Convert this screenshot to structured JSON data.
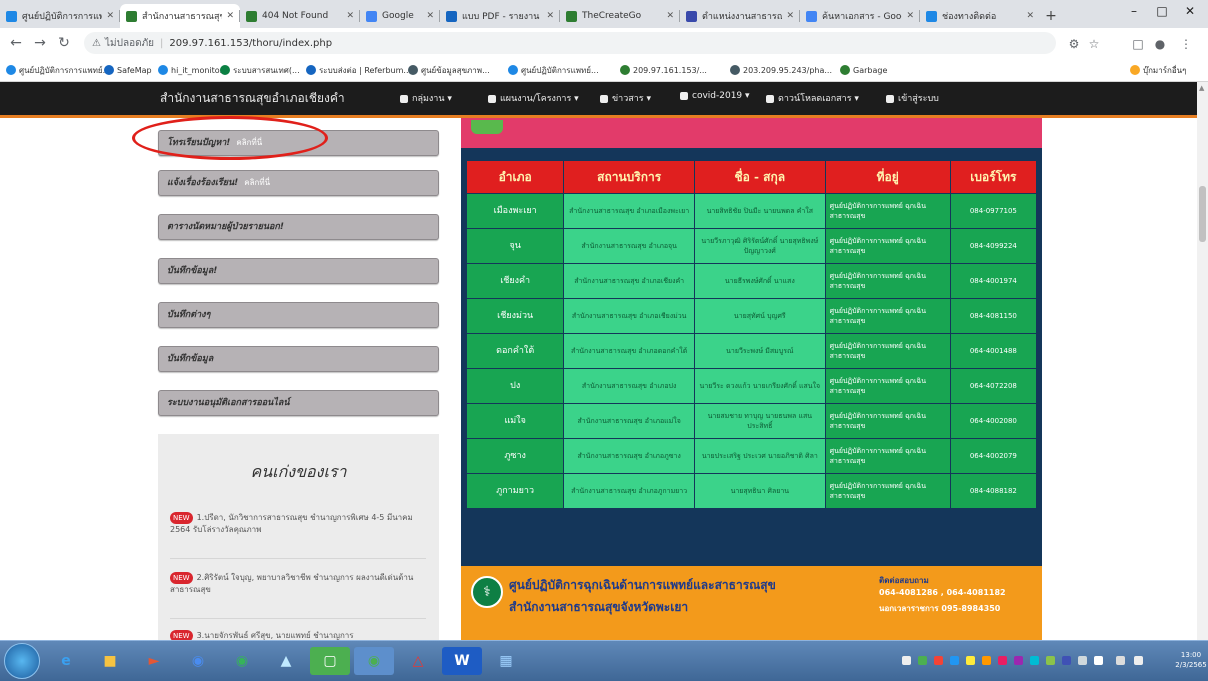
{
  "browser": {
    "tabs": [
      {
        "title": "ศูนย์ปฏิบัติการการแพทย์",
        "active": false,
        "fav": "#1e88e5"
      },
      {
        "title": "สำนักงานสาธารณสุขฯ",
        "active": true,
        "fav": "#2e7d32"
      },
      {
        "title": "404 Not Found",
        "active": false,
        "fav": "#2e7d32"
      },
      {
        "title": "Google",
        "active": false,
        "fav": "#4285f4"
      },
      {
        "title": "แบบ PDF - รายงาน",
        "active": false,
        "fav": "#1565c0"
      },
      {
        "title": "TheCreateGo",
        "active": false,
        "fav": "#2e7d32"
      },
      {
        "title": "ตำแหน่งงานสาธารณสุข",
        "active": false,
        "fav": "#3949ab"
      },
      {
        "title": "ค้นหาเอกสาร - Google",
        "active": false,
        "fav": "#4285f4"
      },
      {
        "title": "ช่องทางติดต่อ",
        "active": false,
        "fav": "#1e88e5"
      }
    ],
    "new_tab": "+",
    "address": {
      "security_label": "ไม่ปลอดภัย",
      "url": "209.97.161.153/thoru/index.php"
    },
    "bookmarks": [
      {
        "label": "ศูนย์ปฏิบัติการการแพทย์...",
        "color": "#1e88e5"
      },
      {
        "label": "SafeMap",
        "color": "#1565c0"
      },
      {
        "label": "hi_it_monitor",
        "color": "#1e88e5"
      },
      {
        "label": "ระบบสารสนเทศ(...",
        "color": "#0b8043"
      },
      {
        "label": "ระบบส่งต่อ | Referbum...",
        "color": "#1565c0"
      },
      {
        "label": "ศูนย์ข้อมูลสุขภาพ...",
        "color": "#455a64"
      },
      {
        "label": "ศูนย์ปฏิบัติการแพทย์...",
        "color": "#1e88e5"
      },
      {
        "label": "209.97.161.153/...",
        "color": "#2e7d32"
      },
      {
        "label": "203.209.95.243/pha...",
        "color": "#455a64"
      },
      {
        "label": "Garbage",
        "color": "#2e7d32"
      },
      {
        "label": "บุ๊กมาร์กอื่นๆ",
        "color": "#f9a825"
      }
    ]
  },
  "site": {
    "brand": "สำนักงานสาธารณสุขอำเภอเชียงคำ",
    "menu": [
      "กลุ่มงาน ▾",
      "แผนงาน/โครงการ ▾",
      "ข่าวสาร ▾",
      "covid-2019 ▾",
      "ดาวน์โหลดเอกสาร ▾",
      "เข้าสู่ระบบ"
    ],
    "sidebar": [
      {
        "title": "โทรเรียนปัญหา!",
        "more": "คลิกที่นี่"
      },
      {
        "title": "แจ้งเรื่องร้องเรียน!",
        "more": "คลิกที่นี่"
      },
      {
        "title": "ตารางนัดหมายผู้ป่วยรายนอก!",
        "more": ""
      },
      {
        "title": "บันทึกข้อมูล!",
        "more": ""
      },
      {
        "title": "บันทึกต่างๆ",
        "more": ""
      },
      {
        "title": "บันทึกข้อมูล",
        "more": ""
      },
      {
        "title": "ระบบงานอนุมัติเอกสารออนไลน์",
        "more": ""
      }
    ],
    "panel_title": "คนเก่งของเรา",
    "staff": [
      "1.ปรีดา, นักวิชาการสาธารณสุข ชำนาญการพิเศษ 4-5 มีนาคม 2564 รับโล่รางวัลคุณภาพ",
      "2.ศิริรัตน์ ใจบุญ, พยาบาลวิชาชีพ ชำนาญการ ผลงานดีเด่นด้านสาธารณสุข",
      "3.นายจักรพันธ์ ศรีสุข, นายแพทย์ ชำนาญการ"
    ],
    "table": {
      "headers": [
        "อำเภอ",
        "สถานบริการ",
        "ชื่อ - สกุล",
        "ที่อยู่",
        "เบอร์โทร"
      ],
      "rows": [
        [
          "เมืองพะเยา",
          "สำนักงานสาธารณสุข อำเภอเมืองพะเยา",
          "นายสิทธิชัย ปินมีะ นายนพดล คำใส",
          "ศูนย์ปฏิบัติการการแพทย์ ฉุกเฉินสาธารณสุข",
          "084-0977105"
        ],
        [
          "จุน",
          "สำนักงานสาธารณสุข อำเภอจุน",
          "นายวีรภาวุฒิ ศิริรัตน์ศักดิ์ นายสุทธิพงษ์ ปัญญาวงศ์",
          "ศูนย์ปฏิบัติการการแพทย์ ฉุกเฉินสาธารณสุข",
          "084-4099224"
        ],
        [
          "เชียงคำ",
          "สำนักงานสาธารณสุข อำเภอเชียงคำ",
          "นายธีรพงษ์ศักดิ์ นาแสง",
          "ศูนย์ปฏิบัติการการแพทย์ ฉุกเฉินสาธารณสุข",
          "084-4001974"
        ],
        [
          "เชียงม่วน",
          "สำนักงานสาธารณสุข อำเภอเชียงม่วน",
          "นายสุทัศน์ บุญศรี",
          "ศูนย์ปฏิบัติการการแพทย์ ฉุกเฉินสาธารณสุข",
          "084-4081150"
        ],
        [
          "ดอกคำใต้",
          "สำนักงานสาธารณสุข อำเภอดอกคำใต้",
          "นายวีระพงษ์ มีสมบูรณ์",
          "ศูนย์ปฏิบัติการการแพทย์ ฉุกเฉินสาธารณสุข",
          "064-4001488"
        ],
        [
          "ปง",
          "สำนักงานสาธารณสุข อำเภอปง",
          "นายวีระ ดวงแก้ว นายเกรียงศักดิ์ แสนใจ",
          "ศูนย์ปฏิบัติการการแพทย์ ฉุกเฉินสาธารณสุข",
          "064-4072208"
        ],
        [
          "แม่ใจ",
          "สำนักงานสาธารณสุข อำเภอแม่ใจ",
          "นายสมชาย ทาบุญ นายธนพล แสนประสิทธิ์",
          "ศูนย์ปฏิบัติการการแพทย์ ฉุกเฉินสาธารณสุข",
          "064-4002080"
        ],
        [
          "ภูซาง",
          "สำนักงานสาธารณสุข อำเภอภูซาง",
          "นายประเสริฐ ประเวศ นายอภิชาติ ศิลา",
          "ศูนย์ปฏิบัติการการแพทย์ ฉุกเฉินสาธารณสุข",
          "064-4002079"
        ],
        [
          "ภูกามยาว",
          "สำนักงานสาธารณสุข อำเภอภูกามยาว",
          "นายสุทธินา ศิลยาน",
          "ศูนย์ปฏิบัติการการแพทย์ ฉุกเฉินสาธารณสุข",
          "084-4088182"
        ]
      ]
    },
    "footer": {
      "line1": "ศูนย์ปฏิบัติการฉุกเฉินด้านการแพทย์และสาธารณสุข",
      "line2": "สำนักงานสาธารณสุขจังหวัดพะเยา",
      "contact_title": "ติดต่อสอบถาม",
      "contact_phones": "064-4081286 , 064-4081182",
      "contact_hours": "นอกเวลาราชการ 095-8984350"
    }
  },
  "taskbar": {
    "clock_time": "13:00",
    "clock_date": "2/3/2565"
  }
}
